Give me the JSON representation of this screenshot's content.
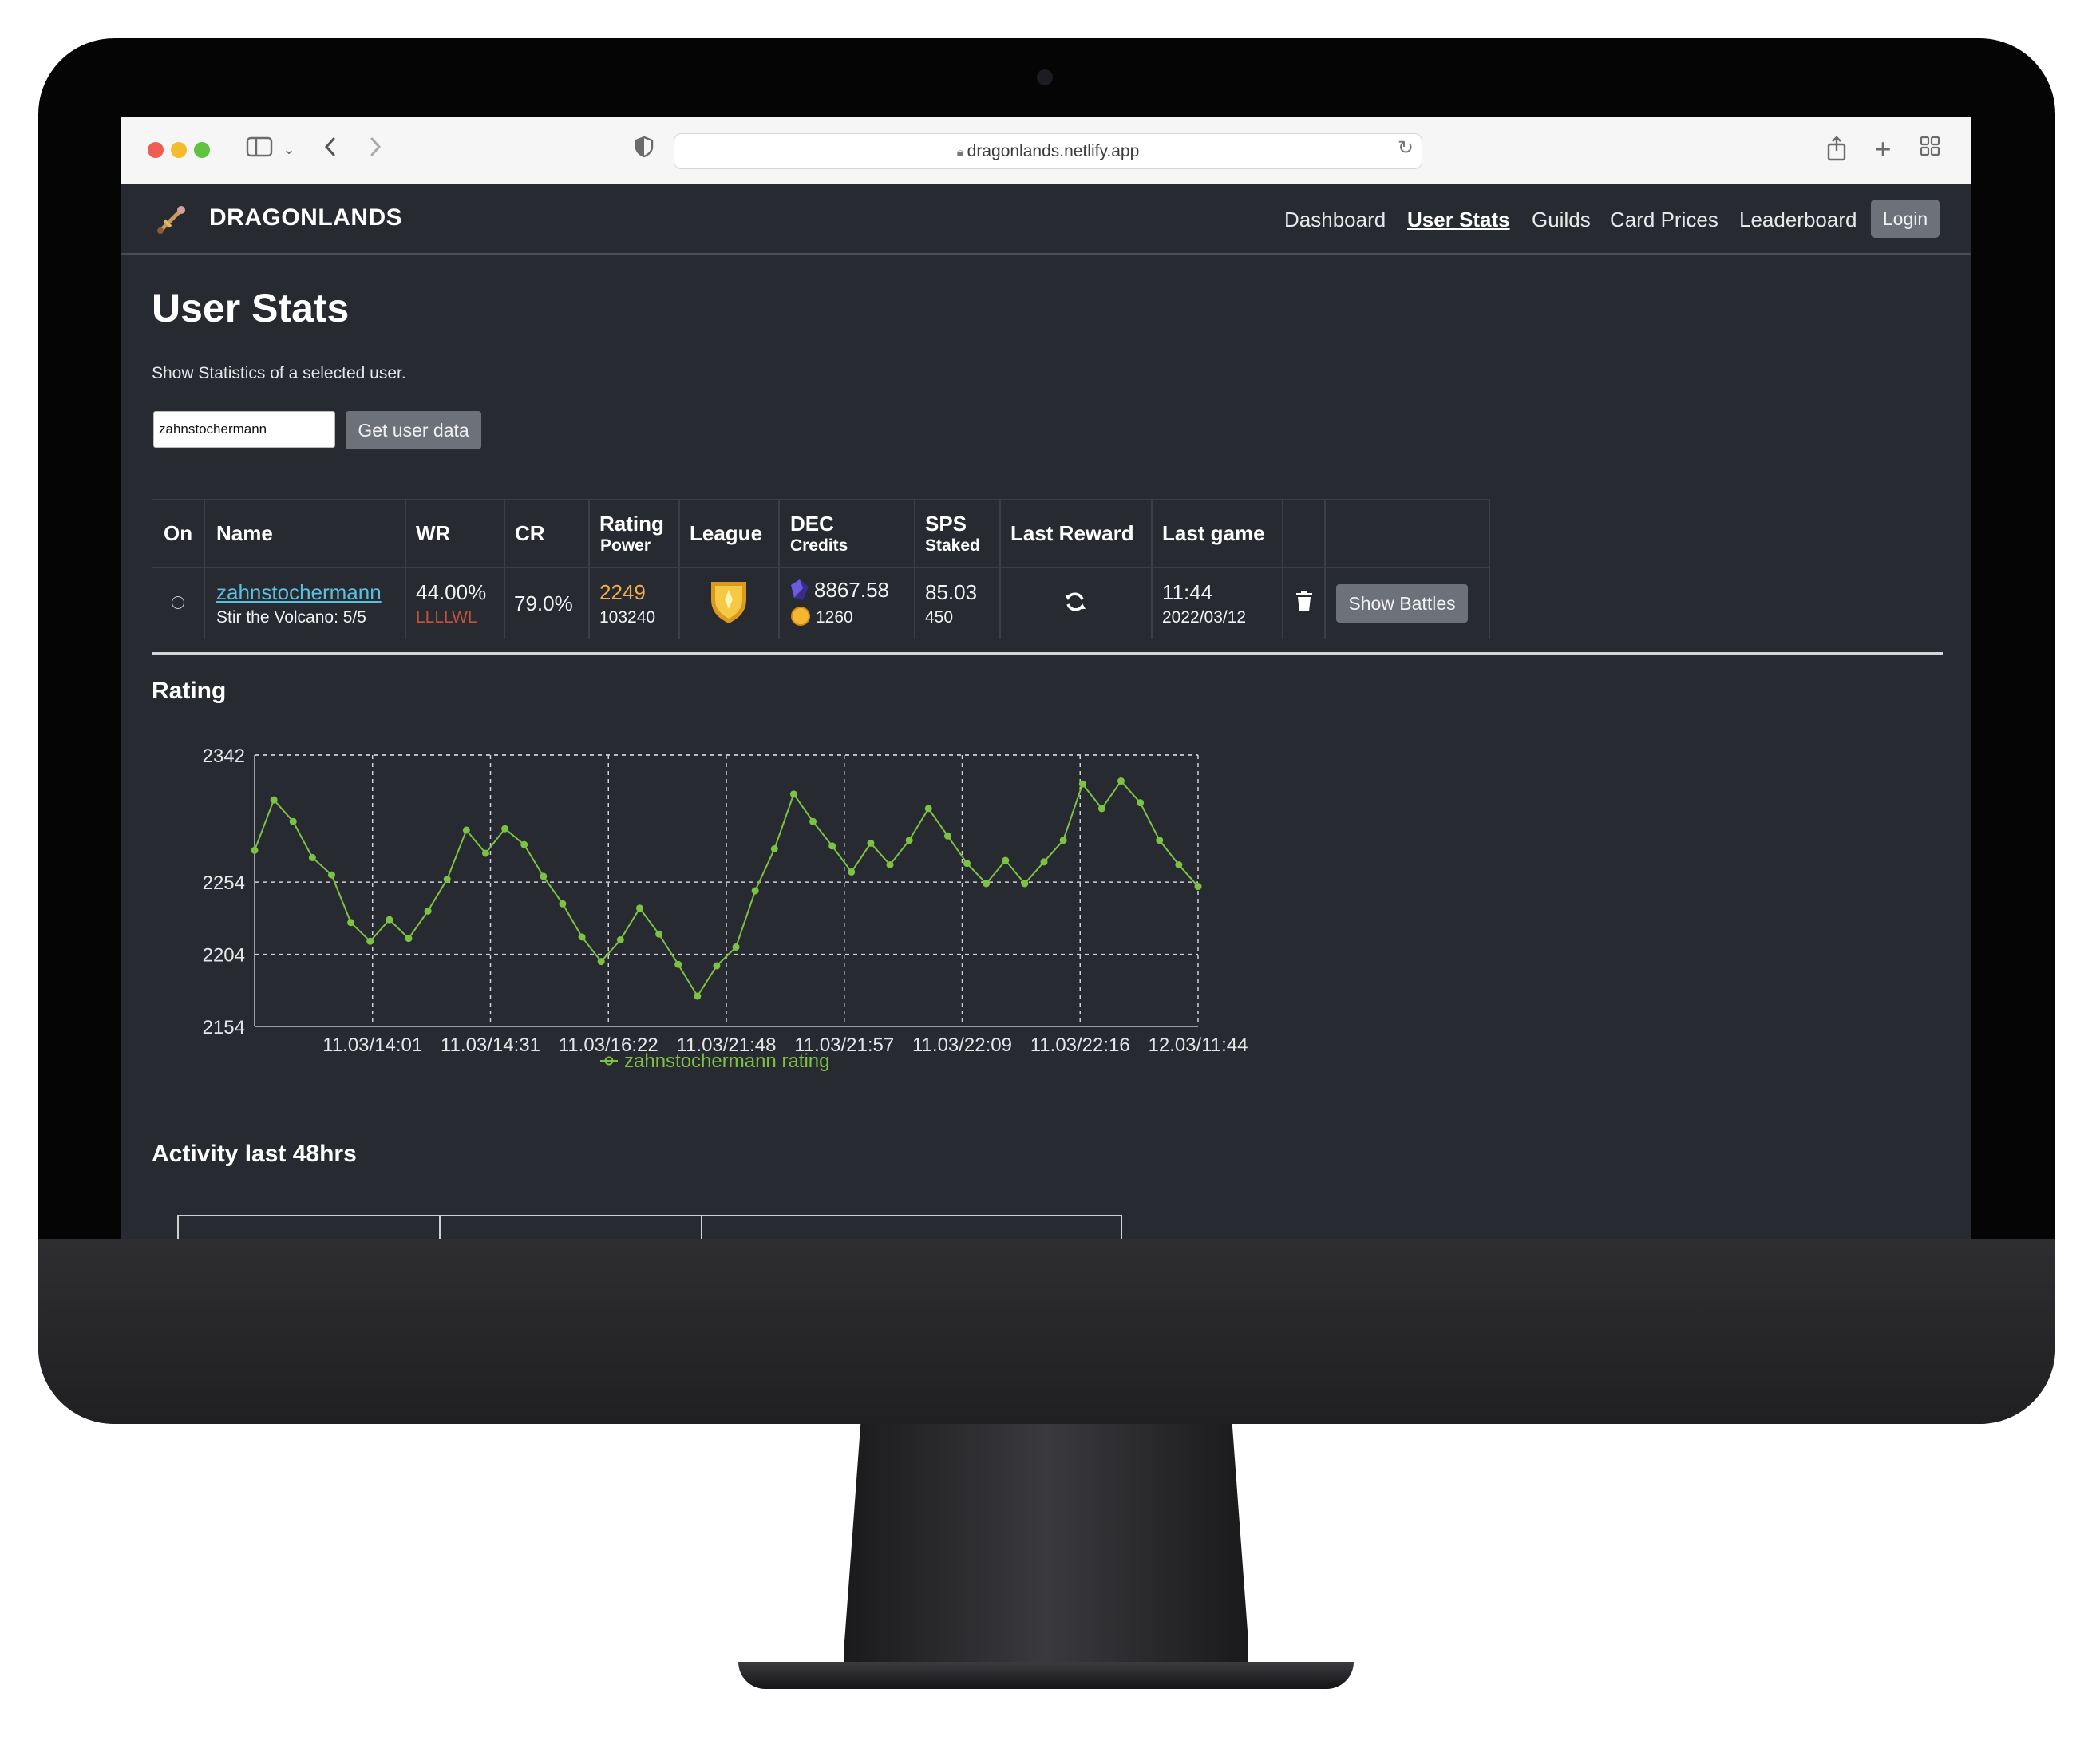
{
  "browser": {
    "url": "dragonlands.netlify.app"
  },
  "navbar": {
    "brand": "DRAGONLANDS",
    "links": [
      "Dashboard",
      "User Stats",
      "Guilds",
      "Card Prices",
      "Leaderboard"
    ],
    "login": "Login"
  },
  "page": {
    "title": "User Stats",
    "subtitle": "Show Statistics of a selected user.",
    "input_value": "zahnstochermann",
    "get_button": "Get user data"
  },
  "table": {
    "headers": {
      "on": "On",
      "name": "Name",
      "wr": "WR",
      "cr": "CR",
      "rating": "Rating",
      "rating_sub": "Power",
      "league": "League",
      "dec": "DEC",
      "dec_sub": "Credits",
      "sps": "SPS",
      "sps_sub": "Staked",
      "last_reward": "Last Reward",
      "last_game": "Last game"
    },
    "row": {
      "name": "zahnstochermann",
      "quest": "Stir the Volcano: 5/5",
      "wr": "44.00%",
      "last_results": "LLLLWL",
      "cr": "79.0%",
      "rating": "2249",
      "power": "103240",
      "dec": "8867.58",
      "credits": "1260",
      "sps": "85.03",
      "staked": "450",
      "last_game_time": "11:44",
      "last_game_date": "2022/03/12",
      "show_battles": "Show Battles"
    },
    "icons": {
      "online": "radio-circle-icon",
      "league": "gold-league-shield-icon",
      "dec": "dec-crystal-icon",
      "credits": "credits-coin-icon",
      "last_reward": "refresh-icon",
      "delete": "trash-icon"
    },
    "colors": {
      "link": "#5bc0de",
      "rating": "#f0ad4e",
      "results": "#c0533a"
    }
  },
  "rating_section": {
    "title": "Rating"
  },
  "chart_data": {
    "type": "line",
    "title": "",
    "y_ticks": [
      2342,
      2254,
      2204,
      2154
    ],
    "ylim": [
      2154,
      2342
    ],
    "x_tick_labels": [
      "11.03/14:01",
      "11.03/14:31",
      "11.03/16:22",
      "11.03/21:48",
      "11.03/21:57",
      "11.03/22:09",
      "11.03/22:16",
      "12.03/11:44"
    ],
    "grid": true,
    "legend_position": "bottom-center",
    "series": [
      {
        "name": "zahnstochermann rating",
        "color": "#7dc242",
        "values": [
          2276,
          2311,
          2296,
          2271,
          2259,
          2226,
          2213,
          2228,
          2215,
          2234,
          2256,
          2290,
          2274,
          2291,
          2280,
          2258,
          2239,
          2216,
          2199,
          2214,
          2236,
          2218,
          2197,
          2175,
          2196,
          2209,
          2248,
          2277,
          2315,
          2296,
          2279,
          2261,
          2281,
          2266,
          2283,
          2305,
          2286,
          2267,
          2253,
          2269,
          2253,
          2268,
          2283,
          2322,
          2305,
          2324,
          2309,
          2283,
          2266,
          2251
        ]
      }
    ]
  },
  "activity_section": {
    "title": "Activity last 48hrs"
  }
}
